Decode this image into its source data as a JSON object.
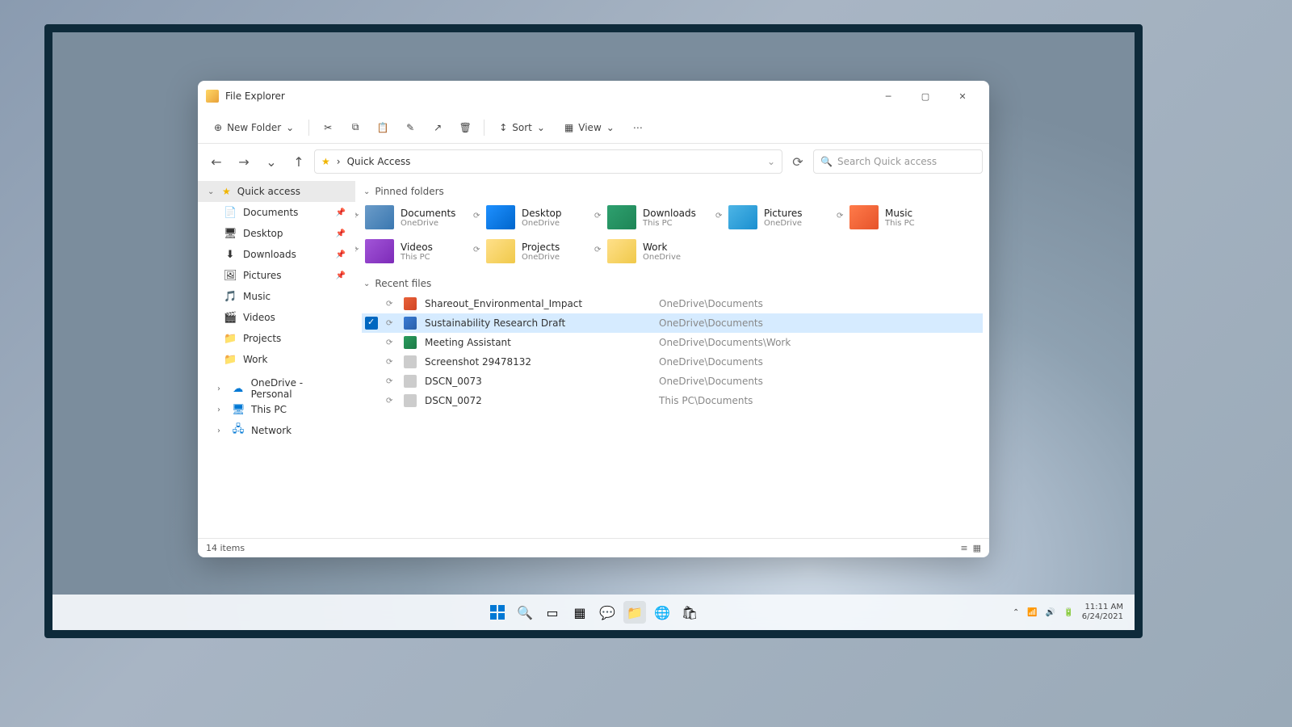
{
  "window": {
    "title": "File Explorer"
  },
  "toolbar": {
    "new_folder": "New Folder",
    "sort": "Sort",
    "view": "View"
  },
  "address": {
    "path": "Quick Access"
  },
  "search": {
    "placeholder": "Search Quick access"
  },
  "sidebar": {
    "quick_access": "Quick access",
    "items": [
      {
        "label": "Documents",
        "icon": "📄"
      },
      {
        "label": "Desktop",
        "icon": "🖥"
      },
      {
        "label": "Downloads",
        "icon": "⬇"
      },
      {
        "label": "Pictures",
        "icon": "🖼"
      },
      {
        "label": "Music",
        "icon": "🎵"
      },
      {
        "label": "Videos",
        "icon": "🎬"
      },
      {
        "label": "Projects",
        "icon": "📁"
      },
      {
        "label": "Work",
        "icon": "📁"
      }
    ],
    "onedrive": "OneDrive - Personal",
    "thispc": "This PC",
    "network": "Network"
  },
  "sections": {
    "pinned": "Pinned folders",
    "recent": "Recent files"
  },
  "pinned": [
    {
      "name": "Documents",
      "loc": "OneDrive",
      "cls": "blue"
    },
    {
      "name": "Desktop",
      "loc": "OneDrive",
      "cls": "desk"
    },
    {
      "name": "Downloads",
      "loc": "This PC",
      "cls": "dl"
    },
    {
      "name": "Pictures",
      "loc": "OneDrive",
      "cls": "pic"
    },
    {
      "name": "Music",
      "loc": "This PC",
      "cls": "mus"
    },
    {
      "name": "Videos",
      "loc": "This PC",
      "cls": "vid"
    },
    {
      "name": "Projects",
      "loc": "OneDrive",
      "cls": "yel"
    },
    {
      "name": "Work",
      "loc": "OneDrive",
      "cls": "yel"
    }
  ],
  "recent": [
    {
      "name": "Shareout_Environmental_Impact",
      "path": "OneDrive\\Documents",
      "cls": "pp",
      "sel": false
    },
    {
      "name": "Sustainability Research Draft",
      "path": "OneDrive\\Documents",
      "cls": "wd",
      "sel": true
    },
    {
      "name": "Meeting Assistant",
      "path": "OneDrive\\Documents\\Work",
      "cls": "ex",
      "sel": false
    },
    {
      "name": "Screenshot 29478132",
      "path": "OneDrive\\Documents",
      "cls": "im",
      "sel": false
    },
    {
      "name": "DSCN_0073",
      "path": "OneDrive\\Documents",
      "cls": "im",
      "sel": false
    },
    {
      "name": "DSCN_0072",
      "path": "This PC\\Documents",
      "cls": "im",
      "sel": false
    }
  ],
  "status": {
    "items": "14 items"
  },
  "tray": {
    "time": "11:11 AM",
    "date": "6/24/2021"
  }
}
